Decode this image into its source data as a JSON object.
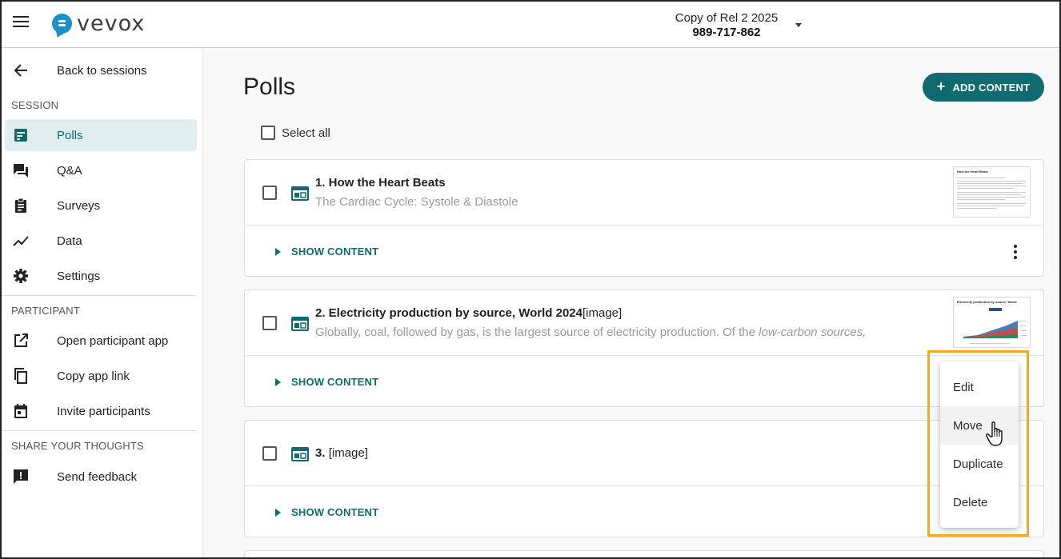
{
  "header": {
    "app_name": "vevox",
    "session_name": "Copy of Rel 2 2025",
    "session_code": "989-717-862"
  },
  "sidebar": {
    "back_label": "Back to sessions",
    "section_session": "SESSION",
    "session_items": [
      {
        "label": "Polls",
        "icon": "poll-icon",
        "active": true
      },
      {
        "label": "Q&A",
        "icon": "forum-icon"
      },
      {
        "label": "Surveys",
        "icon": "clipboard-icon"
      },
      {
        "label": "Data",
        "icon": "trend-icon"
      },
      {
        "label": "Settings",
        "icon": "gear-icon"
      }
    ],
    "section_participant": "PARTICIPANT",
    "participant_items": [
      {
        "label": "Open participant app",
        "icon": "open-external-icon"
      },
      {
        "label": "Copy app link",
        "icon": "copy-icon"
      },
      {
        "label": "Invite participants",
        "icon": "calendar-icon"
      }
    ],
    "section_feedback": "SHARE YOUR THOUGHTS",
    "feedback_items": [
      {
        "label": "Send feedback",
        "icon": "feedback-icon"
      }
    ]
  },
  "main": {
    "title": "Polls",
    "add_button": "ADD CONTENT",
    "select_all": "Select all",
    "show_content": "SHOW CONTENT",
    "polls": [
      {
        "title": "1. How the Heart Beats",
        "subtitle": "The Cardiac Cycle: Systole & Diastole",
        "thumb_title": "How the Heart Beats"
      },
      {
        "title": "2. Electricity production by source, World 2024",
        "title_tag": "[image]",
        "subtitle_plain": "Globally, coal, followed by gas, is the largest source of electricity production. Of the ",
        "subtitle_italic": "low-carbon sources,",
        "thumb_title": "Electricity production by source, World"
      },
      {
        "title": "3. ",
        "title_tag": "[image]"
      }
    ]
  },
  "context_menu": {
    "items": [
      "Edit",
      "Move",
      "Duplicate",
      "Delete"
    ],
    "hovered": "Move"
  },
  "colors": {
    "accent": "#0f6b70",
    "active_bg": "#e1eeef",
    "highlight": "#f5a623",
    "logo_blue": "#1d8fc9"
  }
}
